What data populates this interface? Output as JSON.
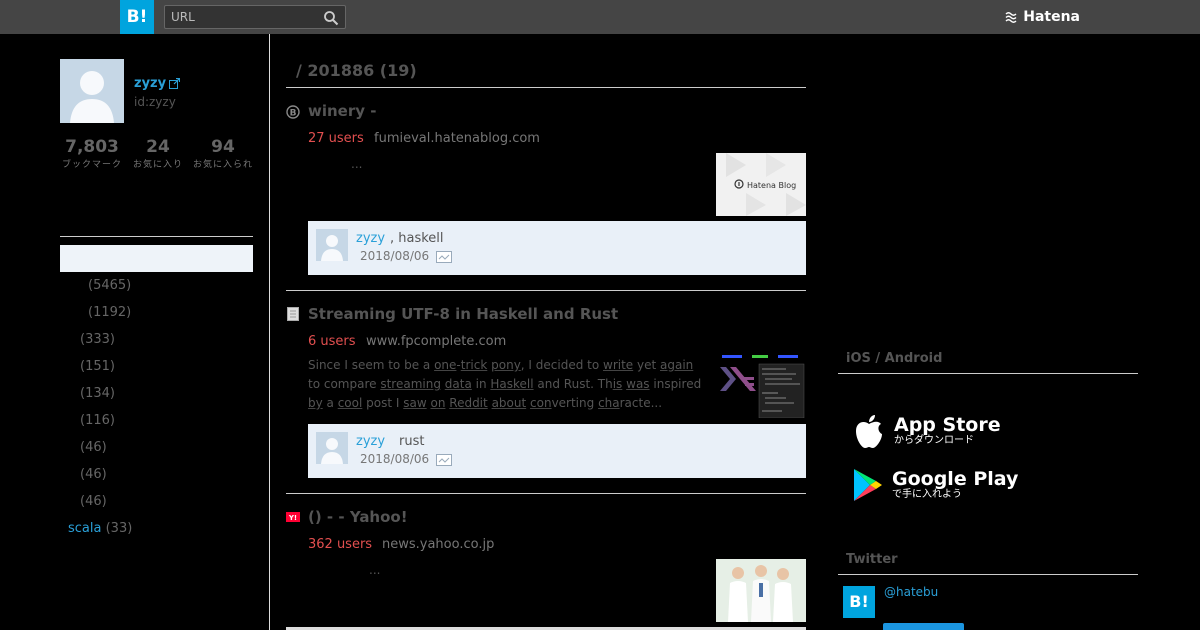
{
  "topbar": {
    "logo": "B!",
    "search_placeholder": "URL",
    "brand": "Hatena"
  },
  "profile": {
    "name": "zyzy",
    "id": "id:zyzy",
    "stats": [
      {
        "num": "7,803",
        "label": "ブックマーク"
      },
      {
        "num": "24",
        "label": "お気に入り"
      },
      {
        "num": "94",
        "label": "お気に入られ"
      }
    ]
  },
  "tags": [
    {
      "name": "",
      "count": "(5465)"
    },
    {
      "name": "",
      "count": "(1192)"
    },
    {
      "name": "",
      "count": "(333)"
    },
    {
      "name": "",
      "count": "(151)"
    },
    {
      "name": "",
      "count": "(134)"
    },
    {
      "name": "",
      "count": "(116)"
    },
    {
      "name": "",
      "count": "(46)"
    },
    {
      "name": "",
      "count": "(46)"
    },
    {
      "name": "",
      "count": "(46)"
    },
    {
      "name": "scala",
      "count": "(33)"
    }
  ],
  "main": {
    "title": "/ 201886 (19)",
    "entries": [
      {
        "title": "winery -",
        "users": "27 users",
        "domain": "fumieval.hatenablog.com",
        "desc": "...",
        "thumb_label": "Hatena Blog",
        "bookmark": {
          "user": "zyzy",
          "comment": ", haskell",
          "date": "2018/08/06"
        }
      },
      {
        "title": "Streaming UTF-8 in Haskell and Rust",
        "users": "6 users",
        "domain": "www.fpcomplete.com",
        "desc_words": [
          "Since I seem to be a ",
          "one",
          "-",
          "trick",
          " ",
          "pony",
          ", I decided to ",
          "write",
          " yet ",
          "again",
          " to compare ",
          "streaming",
          " ",
          "data",
          " in ",
          "Haskell",
          " and Rust. Th",
          "is",
          " ",
          "was",
          " inspired ",
          "by",
          " a ",
          "cool",
          " post I ",
          "saw",
          " ",
          "on",
          " ",
          "Reddit",
          " ",
          "about",
          " ",
          "con",
          "verting ",
          "cha",
          "racte..."
        ],
        "bookmark": {
          "user": "zyzy",
          "comment": "rust",
          "date": "2018/08/06"
        }
      },
      {
        "title": "() -  - Yahoo!",
        "users": "362 users",
        "domain": "news.yahoo.co.jp",
        "desc": "..."
      }
    ]
  },
  "right": {
    "apps_heading": "iOS / Android",
    "appstore": {
      "big": "App Store",
      "small": "からダウンロード"
    },
    "googleplay": {
      "big": "Google Play",
      "small": "で手に入れよう"
    },
    "twitter_heading": "Twitter",
    "twitter_logo": "B!",
    "twitter_handle": "@hatebu"
  }
}
